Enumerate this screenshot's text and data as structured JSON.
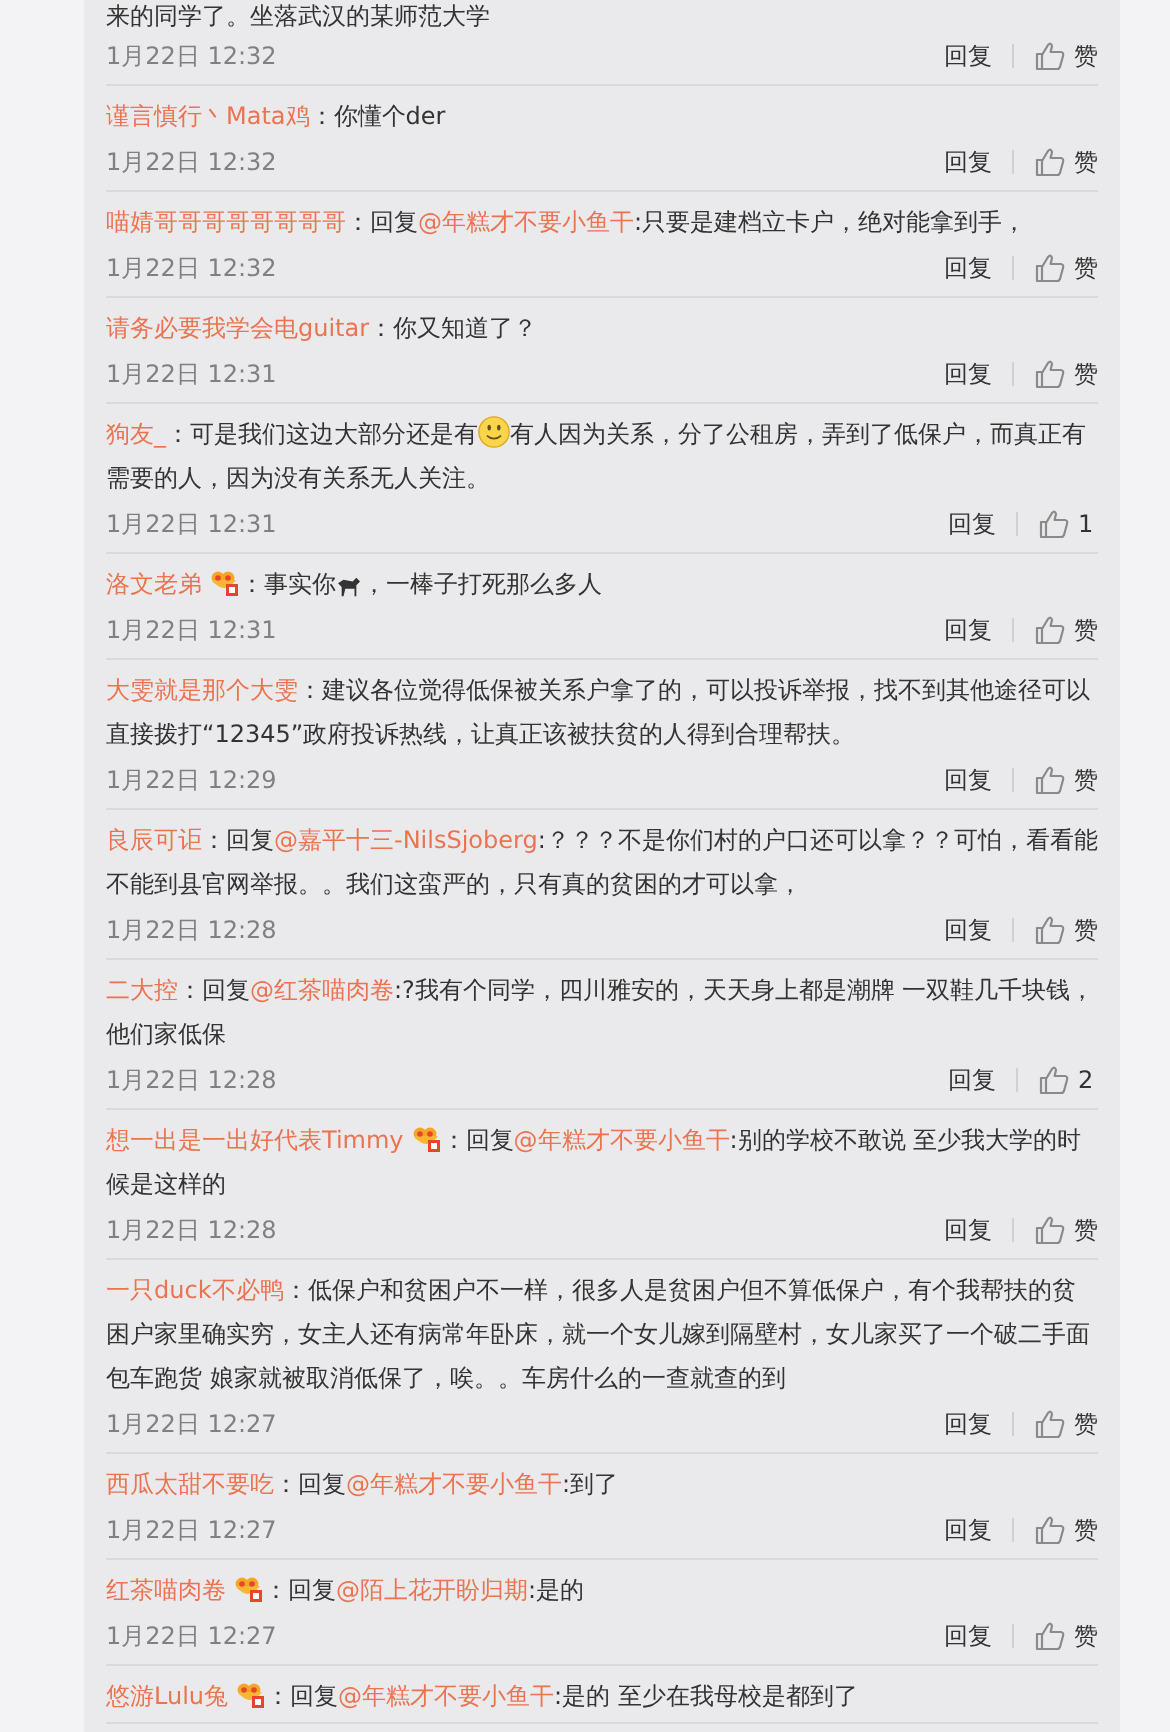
{
  "comments": [
    {
      "body": [
        {
          "kind": "text",
          "text": "来的同学了。坐落武汉的某师范大学"
        }
      ],
      "date": "1月22日 12:32",
      "reply": "回复",
      "like": "赞"
    },
    {
      "author": "谨言慎行丶Mata鸡",
      "badge": false,
      "body": [
        {
          "kind": "text",
          "text": "：你懂个der"
        }
      ],
      "date": "1月22日 12:32",
      "reply": "回复",
      "like": "赞"
    },
    {
      "author": "喵婧哥哥哥哥哥哥哥哥",
      "badge": false,
      "body": [
        {
          "kind": "text",
          "text": "：回复"
        },
        {
          "kind": "mention",
          "text": "@年糕才不要小鱼干"
        },
        {
          "kind": "text",
          "text": ":只要是建档立卡户，绝对能拿到手，"
        }
      ],
      "date": "1月22日 12:32",
      "reply": "回复",
      "like": "赞"
    },
    {
      "author": "请务必要我学会电guitar",
      "badge": false,
      "body": [
        {
          "kind": "text",
          "text": "：你又知道了？"
        }
      ],
      "date": "1月22日 12:31",
      "reply": "回复",
      "like": "赞"
    },
    {
      "author": "狗友_",
      "badge": false,
      "body": [
        {
          "kind": "text",
          "text": "：可是我们这边大部分还是有"
        },
        {
          "kind": "smiley"
        },
        {
          "kind": "text",
          "text": "有人因为关系，分了公租房，弄到了低保户，而真正有需要的人，因为没有关系无人关注。"
        }
      ],
      "date": "1月22日 12:31",
      "reply": "回复",
      "like": "1"
    },
    {
      "author": "洛文老弟",
      "badge": true,
      "body": [
        {
          "kind": "text",
          "text": "：事实你"
        },
        {
          "kind": "horse"
        },
        {
          "kind": "text",
          "text": "，一棒子打死那么多人"
        }
      ],
      "date": "1月22日 12:31",
      "reply": "回复",
      "like": "赞"
    },
    {
      "author": "大雯就是那个大雯",
      "badge": false,
      "body": [
        {
          "kind": "text",
          "text": "：建议各位觉得低保被关系户拿了的，可以投诉举报，找不到其他途径可以直接拨打“12345”政府投诉热线，让真正该被扶贫的人得到合理帮扶。"
        }
      ],
      "date": "1月22日 12:29",
      "reply": "回复",
      "like": "赞"
    },
    {
      "author": "良辰可讵",
      "badge": false,
      "body": [
        {
          "kind": "text",
          "text": "：回复"
        },
        {
          "kind": "mention",
          "text": "@嘉平十三-NilsSjoberg"
        },
        {
          "kind": "text",
          "text": ":？？？不是你们村的户口还可以拿？？可怕，看看能不能到县官网举报。。我们这蛮严的，只有真的贫困的才可以拿，"
        }
      ],
      "date": "1月22日 12:28",
      "reply": "回复",
      "like": "赞"
    },
    {
      "author": "二大控",
      "badge": false,
      "body": [
        {
          "kind": "text",
          "text": "：回复"
        },
        {
          "kind": "mention",
          "text": "@红茶喵肉卷"
        },
        {
          "kind": "text",
          "text": ":?我有个同学，四川雅安的，天天身上都是潮牌 一双鞋几千块钱，他们家低保"
        }
      ],
      "date": "1月22日 12:28",
      "reply": "回复",
      "like": "2"
    },
    {
      "author": "想一出是一出好代表Timmy",
      "badge": true,
      "body": [
        {
          "kind": "text",
          "text": "：回复"
        },
        {
          "kind": "mention",
          "text": "@年糕才不要小鱼干"
        },
        {
          "kind": "text",
          "text": ":别的学校不敢说 至少我大学的时候是这样的"
        }
      ],
      "date": "1月22日 12:28",
      "reply": "回复",
      "like": "赞"
    },
    {
      "author": "一只duck不必鸭",
      "badge": false,
      "body": [
        {
          "kind": "text",
          "text": "：低保户和贫困户不一样，很多人是贫困户但不算低保户，有个我帮扶的贫困户家里确实穷，女主人还有病常年卧床，就一个女儿嫁到隔壁村，女儿家买了一个破二手面包车跑货 娘家就被取消低保了，唉。。车房什么的一查就查的到"
        }
      ],
      "date": "1月22日 12:27",
      "reply": "回复",
      "like": "赞"
    },
    {
      "author": "西瓜太甜不要吃",
      "badge": false,
      "body": [
        {
          "kind": "text",
          "text": "：回复"
        },
        {
          "kind": "mention",
          "text": "@年糕才不要小鱼干"
        },
        {
          "kind": "text",
          "text": ":到了"
        }
      ],
      "date": "1月22日 12:27",
      "reply": "回复",
      "like": "赞"
    },
    {
      "author": "红茶喵肉卷",
      "badge": true,
      "body": [
        {
          "kind": "text",
          "text": "：回复"
        },
        {
          "kind": "mention",
          "text": "@陌上花开盼归期"
        },
        {
          "kind": "text",
          "text": ":是的"
        }
      ],
      "date": "1月22日 12:27",
      "reply": "回复",
      "like": "赞"
    },
    {
      "author": "悠游Lulu兔",
      "badge": true,
      "body": [
        {
          "kind": "text",
          "text": "：回复"
        },
        {
          "kind": "mention",
          "text": "@年糕才不要小鱼干"
        },
        {
          "kind": "text",
          "text": ":是的 至少在我母校是都到了"
        }
      ]
    }
  ]
}
